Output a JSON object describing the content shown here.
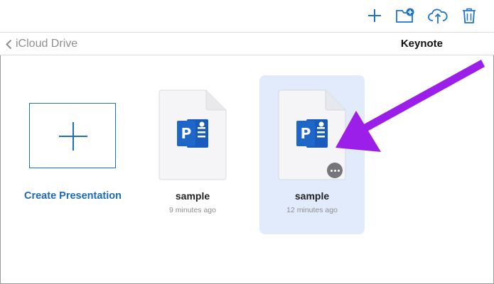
{
  "toolbar": {
    "icons": [
      "add-icon",
      "new-folder-icon",
      "upload-icon",
      "trash-icon"
    ],
    "accent_color": "#1e73d1"
  },
  "nav": {
    "back_label": "iCloud Drive",
    "title": "Keynote"
  },
  "create": {
    "label": "Create Presentation"
  },
  "documents": [
    {
      "name": "sample",
      "time": "9 minutes ago",
      "selected": false
    },
    {
      "name": "sample",
      "time": "12 minutes ago",
      "selected": true
    }
  ],
  "colors": {
    "link": "#1b6ab8",
    "selection": "#e2ebfb",
    "annotation_arrow": "#9b1fe8",
    "powerpoint_blue": "#185abd"
  }
}
